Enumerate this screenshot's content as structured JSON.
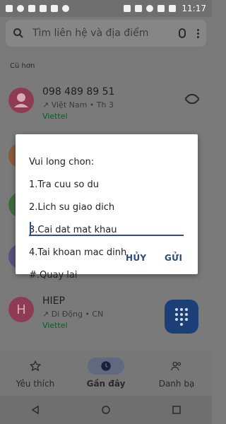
{
  "status_bar": {
    "time": "11:17"
  },
  "search": {
    "placeholder": "Tìm liên hệ và địa điểm"
  },
  "section_label": "Cũ hơn",
  "contacts": [
    {
      "name": "098 489 89 51",
      "sub": "↗ Việt Nam • Th 3",
      "carrier": "Viettel"
    },
    {
      "name": "HIEP",
      "sub": "↗ Di Động • CN",
      "carrier": "Viettel",
      "avatar_letter": "H"
    }
  ],
  "dialog": {
    "message_lines": [
      "Vui long chon:",
      "1.Tra cuu so du",
      "2.Lich su giao dich",
      "3.Cai dat mat khau",
      "4.Tai khoan mac dinh",
      "#.Quay lai"
    ],
    "cancel_label": "HỦY",
    "send_label": "GỬI"
  },
  "bottom_nav": [
    {
      "label": "Yêu thích"
    },
    {
      "label": "Gần đây"
    },
    {
      "label": "Danh bạ"
    }
  ],
  "colors": {
    "accent": "#2f4f86",
    "avatar_pink": "#8e3b55",
    "fab": "#1d3f77"
  }
}
